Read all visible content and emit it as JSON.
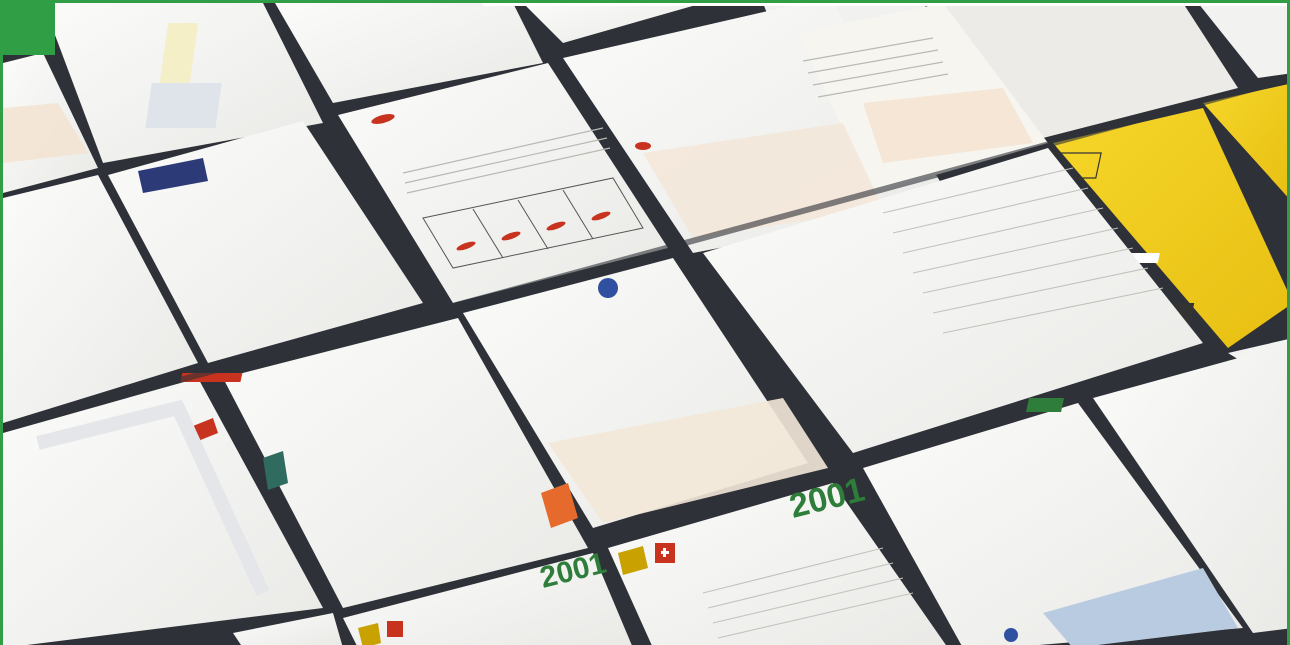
{
  "photo": {
    "subject": "",
    "colors": {
      "frame_green": "#2f9e44",
      "table_dark": "#2e3137",
      "paper": "#f4f4f2",
      "yellow_sheet": "#f2cf1c",
      "accent_red": "#c8331f",
      "accent_green": "#2e7d3a",
      "navy": "#2c3a78"
    }
  },
  "printed_text": {
    "year_left": "2001",
    "year_right": "2001"
  }
}
